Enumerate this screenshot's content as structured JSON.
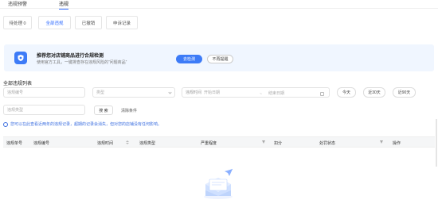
{
  "top_tabs": [
    {
      "label": "违规预警",
      "active": false
    },
    {
      "label": "违规",
      "active": true
    }
  ],
  "sub_tabs": [
    {
      "label": "待处理 0",
      "active": false
    },
    {
      "label": "全部违规",
      "active": true
    },
    {
      "label": "已撤销",
      "active": false
    },
    {
      "label": "申诉记录",
      "active": false
    }
  ],
  "banner": {
    "title": "推荐您对店铺商品进行合规检测",
    "subtitle": "使用官方工具，一键排查存在违规风险的“问题商品”",
    "primary_button": "去检测",
    "secondary_button": "不再提醒",
    "accent": "#3d7bf7"
  },
  "section_title": "全部违规列表",
  "filters": {
    "violation_no_placeholder": "违规编号",
    "type_placeholder": "类型",
    "time_label": "违规时间",
    "start_placeholder": "开始日期",
    "separator": "~",
    "end_placeholder": "结束日期",
    "quick_ranges": [
      "今天",
      "近30天",
      "近90天"
    ],
    "violation_type_placeholder": "违规类型",
    "search_button": "搜 索",
    "clear_link": "清除条件"
  },
  "notice": "您可以在此查看近两年的违规记录，超期的记录会消失，但对您的店铺没有任何影响。",
  "table": {
    "columns": [
      "违规单号",
      "违规编号",
      "违规时间",
      "违规类型",
      "严重程度",
      "扣分",
      "处罚状态",
      "操作"
    ]
  }
}
